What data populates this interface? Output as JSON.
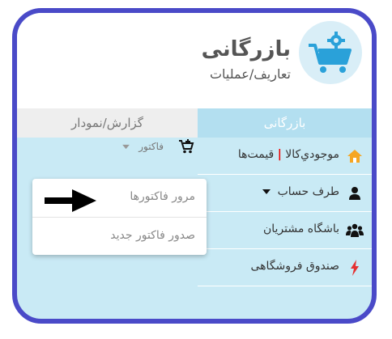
{
  "header": {
    "title": "بازرگانی",
    "subtitle": "تعاریف/عملیات",
    "logo_icon": "cart-gear-icon"
  },
  "tabs": [
    {
      "label": "بازرگانی",
      "active": true
    },
    {
      "label": "گزارش/نمودار",
      "active": false
    }
  ],
  "menu": {
    "items": [
      {
        "label_a": "موجودیِ‌کالا",
        "separator": "|",
        "label_b": "قیمت‌ها",
        "icon": "home-icon"
      },
      {
        "label": "طرف حساب",
        "icon": "user-icon",
        "has_caret": true
      },
      {
        "label": "باشگاه مشتریان",
        "icon": "users-icon"
      },
      {
        "label": "صندوق فروشگاهی",
        "icon": "bolt-icon"
      }
    ]
  },
  "factor": {
    "label": "فاکتور",
    "icon": "cart-plus-icon"
  },
  "dropdown": {
    "items": [
      {
        "label": "مرور فاکتورها"
      },
      {
        "label": "صدور فاکتور جدید"
      }
    ]
  },
  "colors": {
    "frame": "#4a4ac8",
    "panel": "#c9eaf5",
    "active_tab": "#b3dff0",
    "logo_bg": "#d9eef7",
    "logo_cart": "#2aa1d9",
    "home": "#f5a623",
    "bolt": "#e53030"
  }
}
